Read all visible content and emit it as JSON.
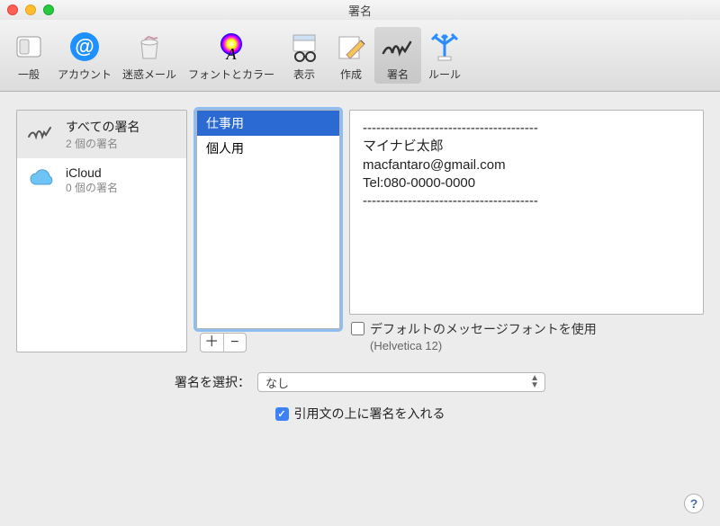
{
  "window": {
    "title": "署名"
  },
  "toolbar": {
    "items": [
      {
        "label": "一般"
      },
      {
        "label": "アカウント"
      },
      {
        "label": "迷惑メール"
      },
      {
        "label": "フォントとカラー"
      },
      {
        "label": "表示"
      },
      {
        "label": "作成"
      },
      {
        "label": "署名"
      },
      {
        "label": "ルール"
      }
    ]
  },
  "accounts": [
    {
      "title": "すべての署名",
      "sub": "2 個の署名"
    },
    {
      "title": "iCloud",
      "sub": "0 個の署名"
    }
  ],
  "signatures": [
    {
      "name": "仕事用",
      "selected": true
    },
    {
      "name": "個人用",
      "selected": false
    }
  ],
  "buttons": {
    "add": "＋",
    "remove": "−"
  },
  "preview": {
    "line1": "---------------------------------------",
    "line2": "マイナビ太郎",
    "line3": "macfantaro@gmail.com",
    "line4": "Tel:080-0000-0000",
    "line5": "---------------------------------------"
  },
  "default_font": {
    "label": "デフォルトのメッセージフォントを使用",
    "sub": "(Helvetica 12)",
    "checked": false
  },
  "select_signature": {
    "label": "署名を選択：",
    "value": "なし"
  },
  "quote": {
    "label": "引用文の上に署名を入れる",
    "checked": true
  },
  "help": "?"
}
